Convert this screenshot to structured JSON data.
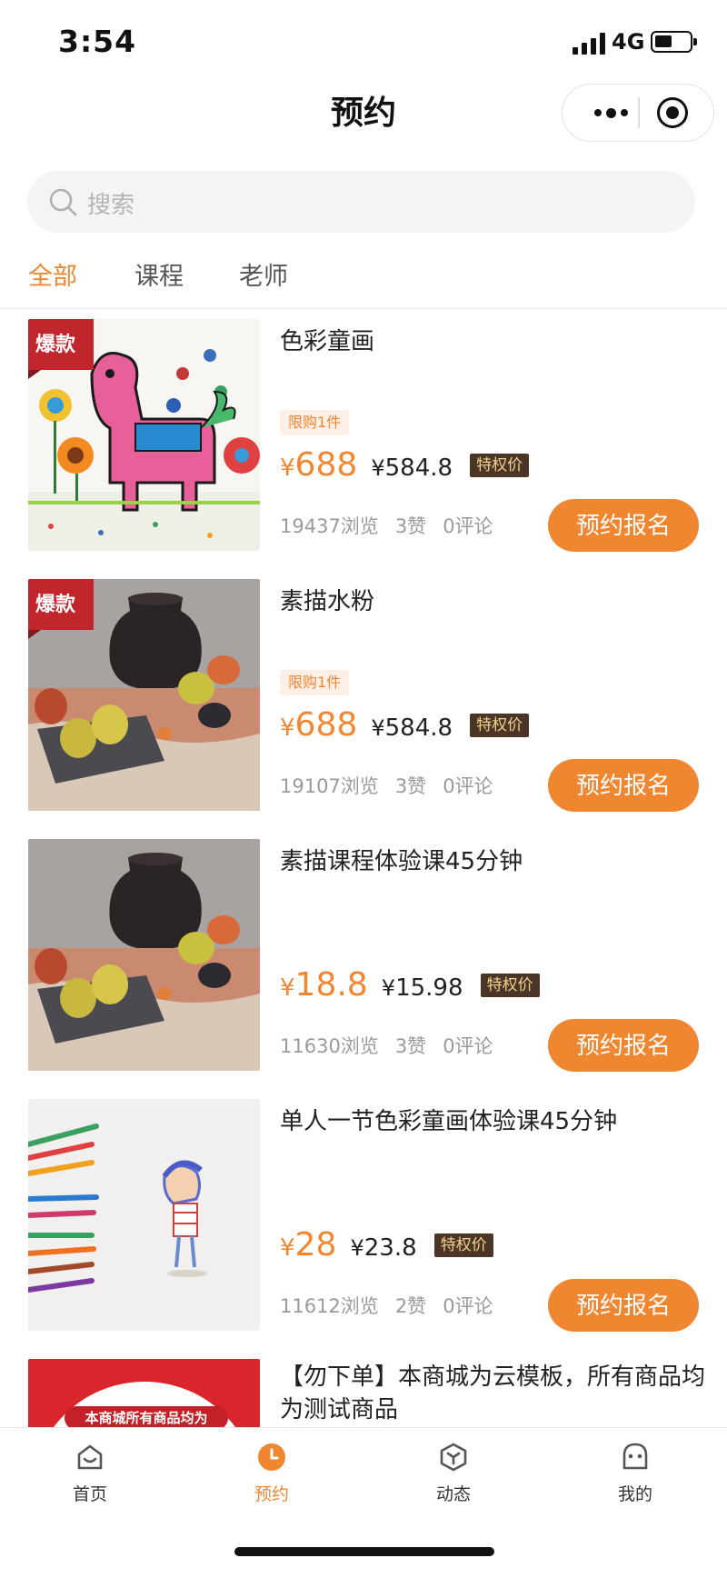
{
  "status_bar": {
    "time": "3:54",
    "network": "4G"
  },
  "nav": {
    "title": "预约"
  },
  "search": {
    "placeholder": "搜索"
  },
  "tabs": [
    {
      "label": "全部",
      "active": true
    },
    {
      "label": "课程",
      "active": false
    },
    {
      "label": "老师",
      "active": false
    }
  ],
  "colors": {
    "accent": "#f08630",
    "hot_badge": "#c0262b",
    "vip_tag_bg": "#4a3526",
    "vip_tag_text": "#f3d08c"
  },
  "products": [
    {
      "title": "色彩童画",
      "hot_badge": "爆款",
      "limit": "限购1件",
      "price_symbol": "¥",
      "price": "688",
      "vip_symbol": "¥",
      "vip_price": "584.8",
      "vip_tag": "特权价",
      "views": "19437浏览",
      "likes": "3赞",
      "comments": "0评论",
      "button": "预约报名",
      "image": "pink-horse-painting"
    },
    {
      "title": "素描水粉",
      "hot_badge": "爆款",
      "limit": "限购1件",
      "price_symbol": "¥",
      "price": "688",
      "vip_symbol": "¥",
      "vip_price": "584.8",
      "vip_tag": "特权价",
      "views": "19107浏览",
      "likes": "3赞",
      "comments": "0评论",
      "button": "预约报名",
      "image": "still-life-vase-pears"
    },
    {
      "title": "素描课程体验课45分钟",
      "price_symbol": "¥",
      "price": "18.8",
      "vip_symbol": "¥",
      "vip_price": "15.98",
      "vip_tag": "特权价",
      "views": "11630浏览",
      "likes": "3赞",
      "comments": "0评论",
      "button": "预约报名",
      "image": "still-life-vase-pears"
    },
    {
      "title": "单人一节色彩童画体验课45分钟",
      "price_symbol": "¥",
      "price": "28",
      "vip_symbol": "¥",
      "vip_price": "23.8",
      "vip_tag": "特权价",
      "views": "11612浏览",
      "likes": "2赞",
      "comments": "0评论",
      "button": "预约报名",
      "image": "colored-pencils-child-drawing"
    },
    {
      "title": "【勿下单】本商城为云模板，所有商品均为测试商品",
      "image_text": "本商城所有商品均为",
      "image": "red-notice-banner"
    }
  ],
  "tabbar": [
    {
      "label": "首页",
      "icon": "home-icon",
      "active": false
    },
    {
      "label": "预约",
      "icon": "clock-icon",
      "active": true
    },
    {
      "label": "动态",
      "icon": "cube-icon",
      "active": false
    },
    {
      "label": "我的",
      "icon": "user-face-icon",
      "active": false
    }
  ]
}
